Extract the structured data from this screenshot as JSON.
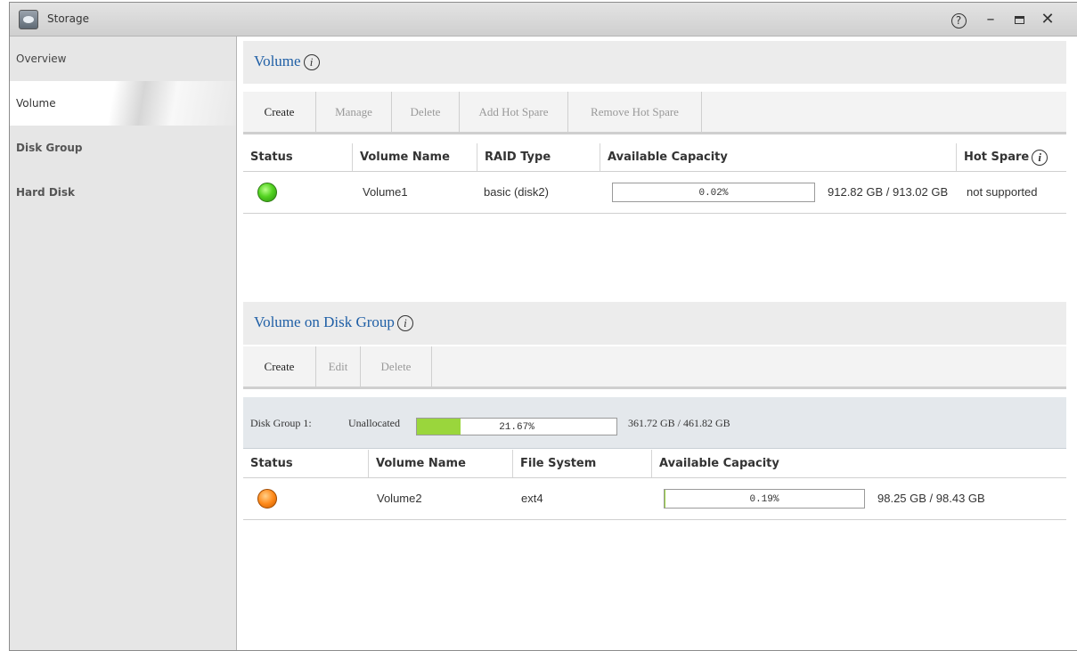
{
  "window": {
    "title": "Storage"
  },
  "sidebar": {
    "items": [
      {
        "label": "Overview"
      },
      {
        "label": "Volume"
      },
      {
        "label": "Disk Group"
      },
      {
        "label": "Hard Disk"
      }
    ]
  },
  "volume_section": {
    "title": "Volume",
    "toolbar": {
      "create": "Create",
      "manage": "Manage",
      "delete": "Delete",
      "add_hot_spare": "Add Hot Spare",
      "remove_hot_spare": "Remove Hot Spare"
    },
    "columns": {
      "status": "Status",
      "volume_name": "Volume Name",
      "raid_type": "RAID Type",
      "available_capacity": "Available Capacity",
      "hot_spare": "Hot Spare"
    },
    "rows": [
      {
        "status_color": "#53d321",
        "volume_name": "Volume1",
        "raid_type": "basic (disk2)",
        "usage_percent_text": "0.02%",
        "usage_fraction": 0.0002,
        "capacity_text": "912.82 GB / 913.02 GB",
        "hot_spare": "not supported"
      }
    ]
  },
  "disk_group_section": {
    "title": "Volume on Disk Group",
    "toolbar": {
      "create": "Create",
      "edit": "Edit",
      "delete": "Delete"
    },
    "disk_group": {
      "label": "Disk Group 1:",
      "unallocated_label": "Unallocated",
      "usage_percent_text": "21.67%",
      "usage_fraction": 0.2167,
      "capacity_text": "361.72 GB / 461.82 GB"
    },
    "columns": {
      "status": "Status",
      "volume_name": "Volume Name",
      "file_system": "File System",
      "available_capacity": "Available Capacity"
    },
    "rows": [
      {
        "status_color": "#ff8a1a",
        "volume_name": "Volume2",
        "file_system": "ext4",
        "usage_percent_text": "0.19%",
        "usage_fraction": 0.0019,
        "capacity_text": "98.25 GB / 98.43 GB"
      }
    ]
  }
}
